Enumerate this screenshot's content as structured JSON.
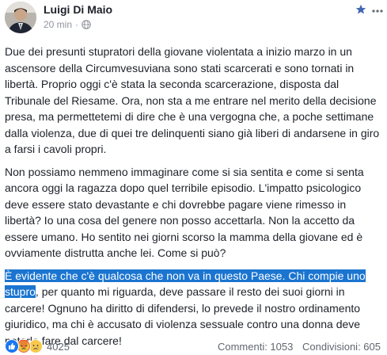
{
  "post": {
    "author": "Luigi Di Maio",
    "time": "20 min",
    "meta_separator": "·",
    "paragraphs": {
      "p1": "Due dei presunti stupratori della giovane violentata a inizio marzo in un ascensore della Circumvesuviana sono stati scarcerati e sono tornati in libertà. Proprio oggi c'è stata la seconda scarcerazione, disposta dal Tribunale del Riesame. Ora, non sta a me entrare nel merito della decisione presa, ma permettetemi di dire che è una vergogna che, a poche settimane dalla violenza, due di quei tre delinquenti siano già liberi di andarsene in giro a farsi i cavoli propri.",
      "p2": "Non possiamo nemmeno immaginare come si sia sentita e come si senta ancora oggi la ragazza dopo quel terribile episodio. L'impatto psicologico deve essere stato devastante e chi dovrebbe pagare viene rimesso in libertà? Io una cosa del genere non posso accettarla. Non la accetto da essere umano. Ho sentito nei giorni scorso la mamma della giovane ed è ovviamente distrutta anche lei. Come si può?",
      "p3_highlight": "È evidente che c'è qualcosa che non va in questo Paese. Chi compie uno stupro",
      "p3_rest": ", per quanto mi riguarda, deve passare il resto dei suoi giorni in carcere! Ognuno ha diritto di difendersi, lo prevede il nostro ordinamento giuridico, ma chi è accusato di violenza sessuale contro una donna deve poterlo fare dal carcere!"
    }
  },
  "footer": {
    "reaction_count": "4025",
    "comments": "Commenti: 1053",
    "shares": "Condivisioni: 605"
  },
  "icons": {
    "globe": "globe-icon",
    "star": "star-icon",
    "more": "more-options-icon",
    "like": "like-reaction-icon",
    "angry": "angry-reaction-icon",
    "sad": "sad-reaction-icon"
  },
  "colors": {
    "highlight": "#1b75d0",
    "like_blue": "#1877f2",
    "angry": "#e8683a",
    "sad": "#f7c84b",
    "meta_gray": "#90949c"
  }
}
